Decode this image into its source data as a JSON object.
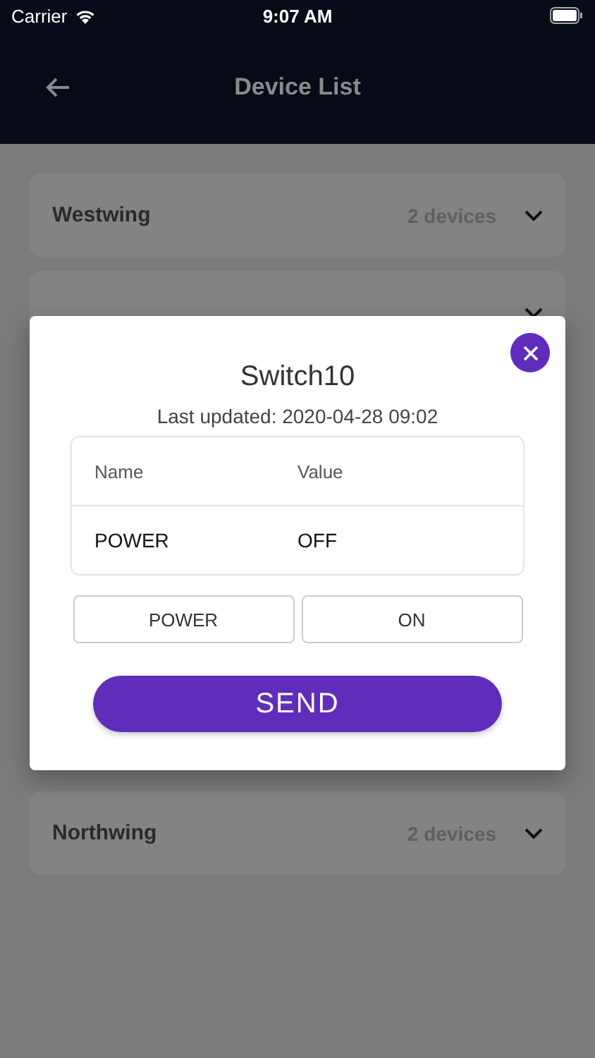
{
  "status_bar": {
    "carrier": "Carrier",
    "time": "9:07 AM"
  },
  "header": {
    "title": "Device List"
  },
  "groups": [
    {
      "name": "Westwing",
      "count": "2 devices",
      "expanded": false
    },
    {
      "expanded": false
    },
    {
      "name": "Northwing",
      "count": "2 devices",
      "expanded": false
    }
  ],
  "dialog": {
    "title": "Switch10",
    "subtitle": "Last updated: 2020-04-28 09:02",
    "table": {
      "columns": [
        "Name",
        "Value"
      ],
      "rows": [
        [
          "POWER",
          "OFF"
        ]
      ]
    },
    "pickers": [
      "POWER",
      "ON"
    ],
    "send_button": "SEND"
  }
}
